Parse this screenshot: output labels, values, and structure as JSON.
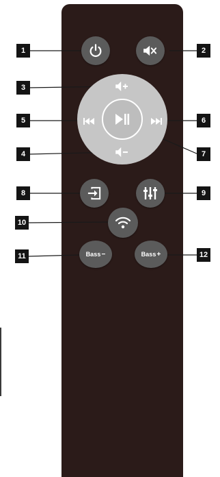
{
  "callouts": [
    "1",
    "2",
    "3",
    "4",
    "5",
    "6",
    "7",
    "8",
    "9",
    "10",
    "11",
    "12"
  ],
  "buttons": {
    "bass_minus": {
      "text": "Bass",
      "sign": "−"
    },
    "bass_plus": {
      "text": "Bass",
      "sign": "+"
    }
  },
  "icons": {
    "1": "power-icon",
    "2": "mute-icon",
    "3": "volume-up-icon",
    "4": "volume-down-icon",
    "5": "previous-track-icon",
    "6": "next-track-icon",
    "7": "play-pause-icon",
    "8": "input-source-icon",
    "9": "equalizer-icon",
    "10": "wifi-icon"
  },
  "colors": {
    "remote_body": "#2b1b19",
    "button": "#5b5b5b",
    "dpad": "#c6c6c6",
    "callout_box": "#141414"
  }
}
